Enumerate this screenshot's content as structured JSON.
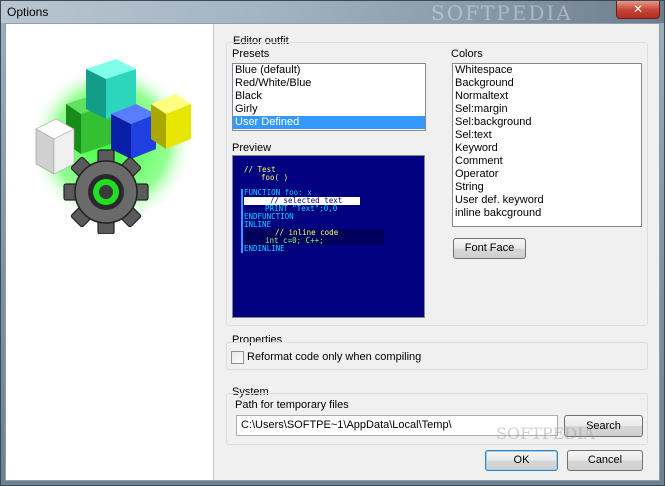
{
  "window": {
    "title": "Options",
    "close_glyph": "✕",
    "watermark": "SOFTPEDIA"
  },
  "editor_outfit": {
    "label": "Editor outfit",
    "presets": {
      "label": "Presets",
      "items": [
        "Blue (default)",
        "Red/White/Blue",
        "Black",
        "Girly",
        "User Defined"
      ],
      "selected": "User Defined"
    },
    "colors": {
      "label": "Colors",
      "items": [
        "Whitespace",
        "Background",
        "Normaltext",
        "Sel:margin",
        "Sel:background",
        "Sel:text",
        "Keyword",
        "Comment",
        "Operator",
        "String",
        "User def. keyword",
        "inline bakcground"
      ]
    },
    "preview": {
      "label": "Preview",
      "lines": [
        "// Test",
        "foo( )",
        "FUNCTION foo: x",
        "// selected text",
        "PRINT \"Text\";0,0",
        "ENDFUNCTION",
        "INLINE",
        "// inline code",
        "int c=0; C++;",
        "ENDINLINE"
      ]
    },
    "font_face_label": "Font Face"
  },
  "properties": {
    "label": "Properties",
    "reformat_label": "Reformat code only when compiling",
    "reformat_checked": false
  },
  "system": {
    "label": "System",
    "temp_path_label": "Path for temporary files",
    "temp_path_value": "C:\\Users\\SOFTPE~1\\AppData\\Local\\Temp\\",
    "search_label": "Search"
  },
  "buttons": {
    "ok": "OK",
    "cancel": "Cancel"
  },
  "colors": {
    "preview_bg": "#000080",
    "selection": "#3399ff",
    "keyword_cyan": "#00d8ff",
    "comment_yellow": "#ffff66",
    "inline_green": "#7cff7c"
  },
  "logo_icon": "cubes-and-gear-icon"
}
